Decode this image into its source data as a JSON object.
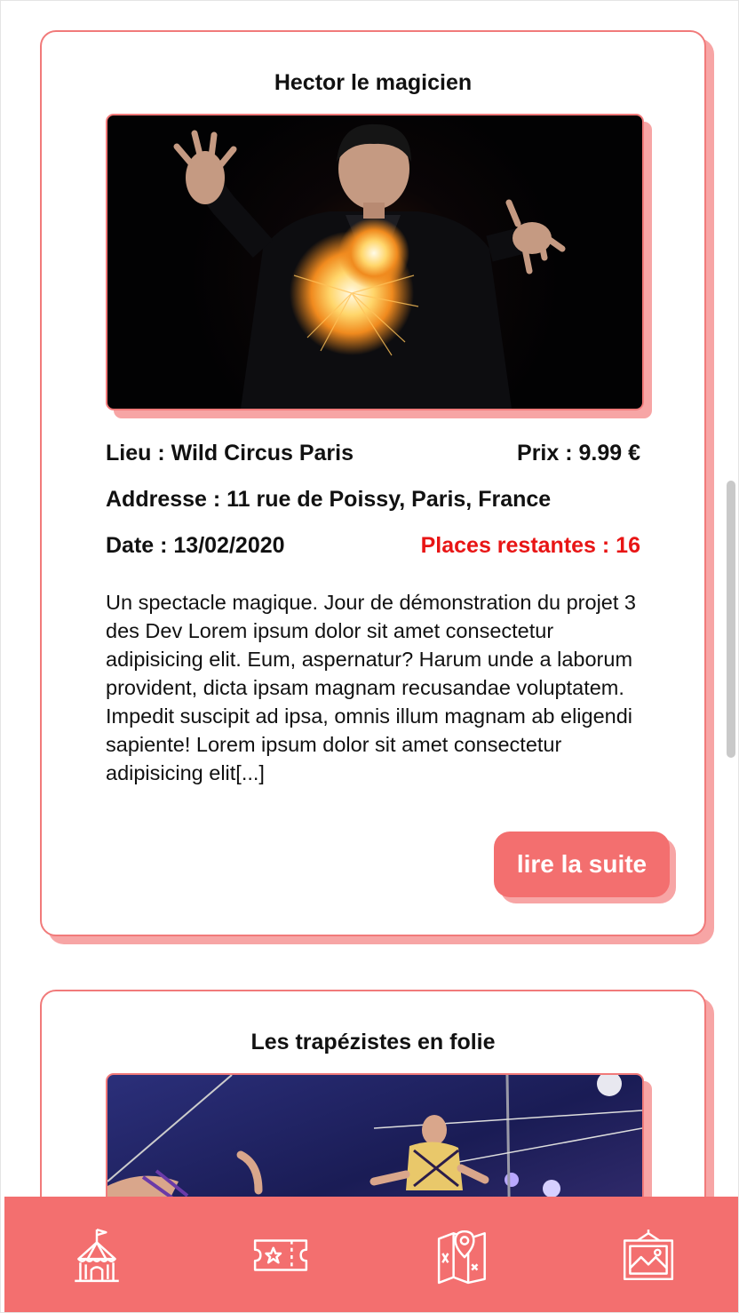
{
  "cards": [
    {
      "title": "Hector le magicien",
      "lieu": "Lieu : Wild Circus Paris",
      "prix": "Prix : 9.99 €",
      "addresse": "Addresse : 11 rue de Poissy, Paris, France",
      "date": "Date : 13/02/2020",
      "places": "Places restantes : 16",
      "description": "Un spectacle magique. Jour de démonstration du projet 3 des Dev Lorem ipsum dolor sit amet consectetur adipisicing elit. Eum, aspernatur? Harum unde a laborum provident, dicta ipsam magnam recusandae voluptatem. Impedit suscipit ad ipsa, omnis illum magnam ab eligendi sapiente! Lorem ipsum dolor sit amet consectetur adipisicing elit[...]",
      "button": "lire la suite"
    },
    {
      "title": "Les trapézistes en folie"
    }
  ],
  "nav": {
    "items": [
      {
        "icon": "circus-tent-icon"
      },
      {
        "icon": "ticket-icon"
      },
      {
        "icon": "map-location-icon"
      },
      {
        "icon": "framed-picture-icon"
      }
    ]
  },
  "colors": {
    "accent": "#f36f6f",
    "shadow": "#f7a5a5",
    "alert": "#e81515"
  }
}
